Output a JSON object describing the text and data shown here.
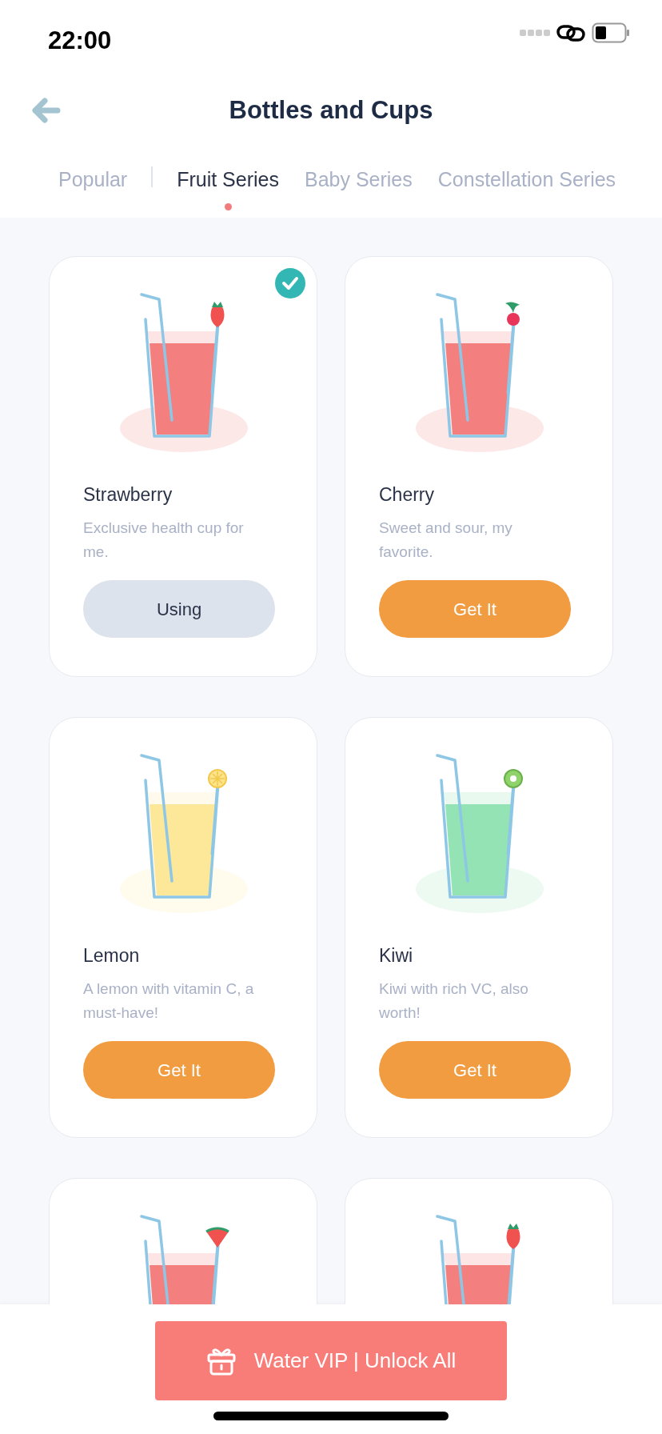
{
  "status_bar": {
    "time": "22:00"
  },
  "header": {
    "title": "Bottles and Cups"
  },
  "tabs": [
    {
      "label": "Popular",
      "selected": false
    },
    {
      "label": "Fruit Series",
      "selected": true
    },
    {
      "label": "Baby Series",
      "selected": false
    },
    {
      "label": "Constellation Series",
      "selected": false
    }
  ],
  "cards": [
    {
      "name": "Strawberry",
      "description": "Exclusive health cup for me.",
      "button": {
        "label": "Using",
        "kind": "using"
      },
      "selected": true,
      "color": "#f47f7f",
      "kind": "strawberry"
    },
    {
      "name": "Cherry",
      "description": "Sweet and sour, my favorite.",
      "button": {
        "label": "Get It",
        "kind": "get"
      },
      "selected": false,
      "color": "#f47f7f",
      "kind": "cherry"
    },
    {
      "name": "Lemon",
      "description": "A lemon with vitamin C, a must-have!",
      "button": {
        "label": "Get It",
        "kind": "get"
      },
      "selected": false,
      "color": "#fde89a",
      "kind": "lemon"
    },
    {
      "name": "Kiwi",
      "description": "Kiwi with rich VC, also worth!",
      "button": {
        "label": "Get It",
        "kind": "get"
      },
      "selected": false,
      "color": "#93e3b4",
      "kind": "kiwi"
    },
    {
      "selected": false,
      "color": "#f47f7f",
      "kind": "watermelon"
    },
    {
      "selected": false,
      "color": "#f47f7f",
      "kind": "strawberry"
    }
  ],
  "vip_button": {
    "label": "Water VIP | Unlock All"
  }
}
